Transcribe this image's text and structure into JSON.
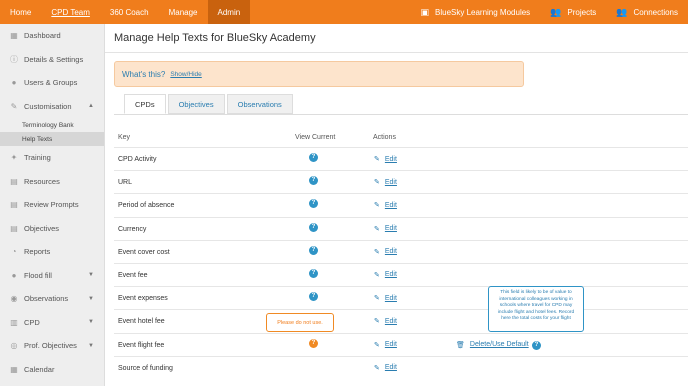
{
  "topnav": {
    "left": [
      "Home",
      "CPD Team",
      "360 Coach",
      "Manage",
      "Admin"
    ],
    "right": [
      {
        "icon": "modules-icon",
        "glyph": "▣",
        "label": "BlueSky Learning Modules"
      },
      {
        "icon": "projects-icon",
        "glyph": "👥",
        "label": "Projects"
      },
      {
        "icon": "connections-icon",
        "glyph": "👥",
        "label": "Connections"
      }
    ]
  },
  "sidebar": {
    "dashboard": "Dashboard",
    "details": "Details & Settings",
    "users": "Users & Groups",
    "customisation": "Customisation",
    "sub": [
      "Terminology Bank",
      "Help Texts"
    ],
    "training": "Training",
    "resources": "Resources",
    "review_prompts": "Review Prompts",
    "objectives": "Objectives",
    "reports": "Reports",
    "flood_fill": "Flood fill",
    "observations": "Observations",
    "cpd": "CPD",
    "prof_objectives": "Prof. Objectives",
    "calendar": "Calendar"
  },
  "main": {
    "title": "Manage Help Texts for BlueSky Academy",
    "whats_this": "What's this?",
    "show_hide": "Show/Hide",
    "tabs": [
      "CPDs",
      "Objectives",
      "Observations"
    ],
    "headers": {
      "key": "Key",
      "view": "View Current",
      "actions": "Actions"
    },
    "edit_label": "Edit",
    "delete_label": "Delete/Use Default",
    "q_glyph": "?",
    "rows": [
      "CPD Activity",
      "URL",
      "Period of absence",
      "Currency",
      "Event cover cost",
      "Event fee",
      "Event expenses",
      "Event hotel fee",
      "Event flight fee",
      "Source of funding"
    ],
    "tooltip_orange": "Please do not use.",
    "tooltip_blue": "This field is likely to be of value to international colleagues working in schools where travel for CPD may include flight and hotel fees. Record here the total costs for your flight"
  }
}
